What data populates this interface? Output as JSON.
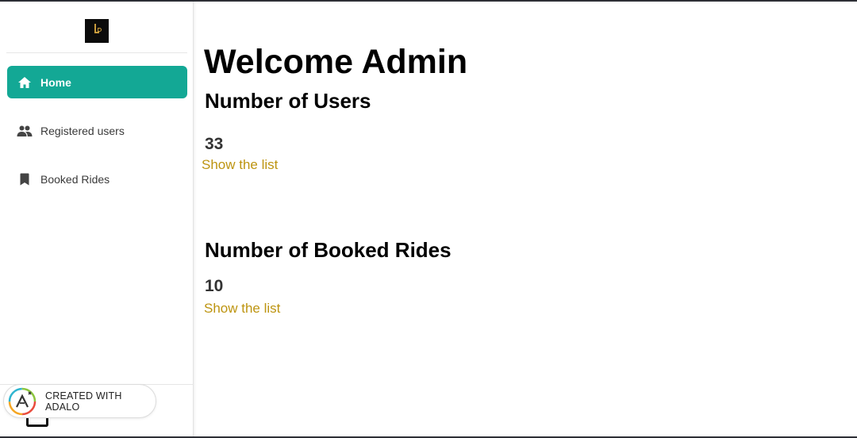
{
  "sidebar": {
    "logo_alt": "app-logo",
    "items": [
      {
        "label": "Home",
        "icon": "home-icon",
        "active": true
      },
      {
        "label": "Registered users",
        "icon": "people-icon",
        "active": false
      },
      {
        "label": "Booked Rides",
        "icon": "bookmark-icon",
        "active": false
      }
    ],
    "badge_text": "CREATED WITH ADALO"
  },
  "main": {
    "title": "Welcome Admin",
    "users": {
      "heading": "Number of Users",
      "count": "33",
      "link": "Show the list"
    },
    "rides": {
      "heading": "Number of Booked Rides",
      "count": "10",
      "link": "Show the list"
    }
  },
  "colors": {
    "accent": "#13a895",
    "link": "#bd9410",
    "text": "#000000"
  }
}
